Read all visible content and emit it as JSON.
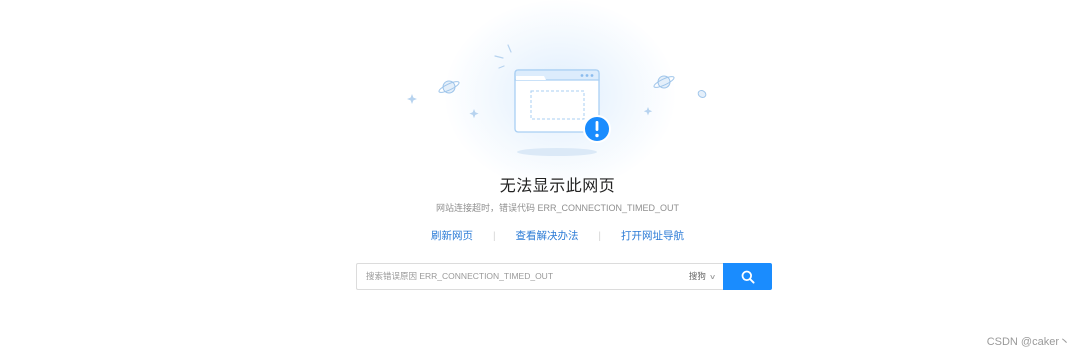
{
  "error": {
    "title": "无法显示此网页",
    "subtitle": "网站连接超时，错误代码 ERR_CONNECTION_TIMED_OUT"
  },
  "links": [
    {
      "label": "刷新网页"
    },
    {
      "label": "查看解决办法"
    },
    {
      "label": "打开网址导航"
    }
  ],
  "links_separator": "|",
  "search": {
    "placeholder": "搜索错误原因 ERR_CONNECTION_TIMED_OUT",
    "engine": "搜狗",
    "engine_chevron": "∨",
    "button_icon": "search-icon"
  },
  "illustration": {
    "icon": "broken-page-window-icon",
    "badge": "!"
  },
  "watermark": "CSDN @caker丶",
  "colors": {
    "accent": "#1a8cfe",
    "link": "#2b7bd6",
    "title": "#222222",
    "muted": "#8f8f8f"
  }
}
